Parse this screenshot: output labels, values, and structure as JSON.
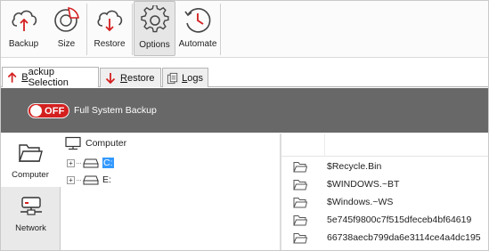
{
  "toolbar": {
    "buttons": [
      {
        "id": "backup",
        "label": "Backup",
        "icon": "cloud-upload-icon"
      },
      {
        "id": "size",
        "label": "Size",
        "icon": "pie-chart-icon"
      },
      {
        "id": "restore",
        "label": "Restore",
        "icon": "cloud-download-icon"
      },
      {
        "id": "options",
        "label": "Options",
        "icon": "gear-icon",
        "active": true
      },
      {
        "id": "automate",
        "label": "Automate",
        "icon": "clock-icon"
      }
    ]
  },
  "tabs": [
    {
      "id": "backup-selection",
      "label_ul": "B",
      "label_rest": "ackup Selection",
      "icon": "arrow-up-icon",
      "active": true
    },
    {
      "id": "restore",
      "label_ul": "R",
      "label_rest": "estore",
      "icon": "arrow-down-icon"
    },
    {
      "id": "logs",
      "label_ul": "L",
      "label_rest": "ogs",
      "icon": "log-icon"
    }
  ],
  "band": {
    "toggle_text": "OFF",
    "label": "Full System Backup"
  },
  "side_tabs": [
    {
      "id": "computer",
      "label": "Computer",
      "icon": "folder-icon",
      "active": true
    },
    {
      "id": "network",
      "label": "Network",
      "icon": "network-drive-icon"
    }
  ],
  "tree": {
    "root": "Computer",
    "drives": [
      {
        "label": "C:",
        "selected": true
      },
      {
        "label": "E:",
        "selected": false
      }
    ]
  },
  "file_list": [
    "$Recycle.Bin",
    "$WINDOWS.~BT",
    "$Windows.~WS",
    "5e745f9800c7f515dfeceb4bf64619",
    "66738aecb799da6e3114ce4a4dc195"
  ],
  "colors": {
    "accent_red": "#d41f1f",
    "band_gray": "#686868",
    "selection_blue": "#3399ff"
  }
}
